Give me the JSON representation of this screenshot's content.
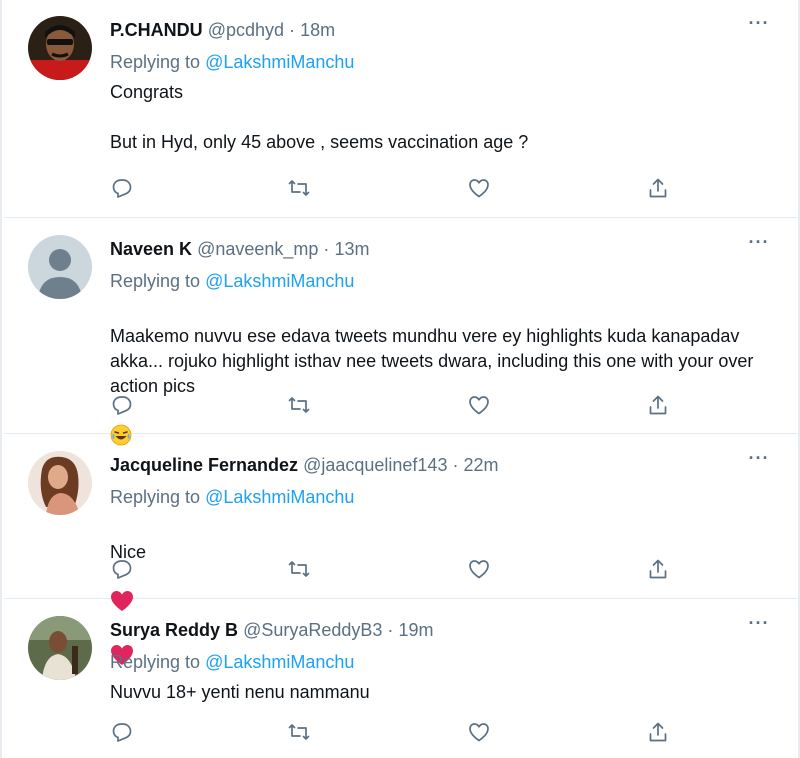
{
  "replying_label": "Replying to",
  "tweets": [
    {
      "name": "P.CHANDU",
      "handle": "@pcdhyd",
      "separator": "·",
      "time": "18m",
      "mention": "@LakshmiManchu",
      "text": "Congrats\n\nBut in Hyd, only 45 above , seems vaccination age ?",
      "more": "···"
    },
    {
      "name": "Naveen K",
      "handle": "@naveenk_mp",
      "separator": "·",
      "time": "13m",
      "mention": "@LakshmiManchu",
      "text": "Maakemo nuvvu ese edava tweets mundhu vere ey highlights kuda kanapadav akka... rojuko highlight isthav nee tweets dwara, including this one with your over action pics",
      "more": "···"
    },
    {
      "name": "Jacqueline Fernandez",
      "handle": "@jaacquelinef143",
      "separator": "·",
      "time": "22m",
      "mention": "@LakshmiManchu",
      "text": "Nice",
      "more": "···"
    },
    {
      "name": "Surya Reddy B",
      "handle": "@SuryaReddyB3",
      "separator": "·",
      "time": "19m",
      "mention": "@LakshmiManchu",
      "text": "Nuvvu 18+ yenti nenu nammanu",
      "more": "···"
    }
  ],
  "emojis": {
    "tweet2": "face-with-tears-of-joy",
    "tweet3": [
      "red-heart",
      "red-heart"
    ]
  },
  "colors": {
    "mention": "#1da1f2",
    "secondary_text": "#5b7083",
    "divider": "#e6ecf0",
    "heart": "#e0245e"
  },
  "icons": [
    "reply-icon",
    "retweet-icon",
    "like-icon",
    "share-icon",
    "more-icon"
  ]
}
